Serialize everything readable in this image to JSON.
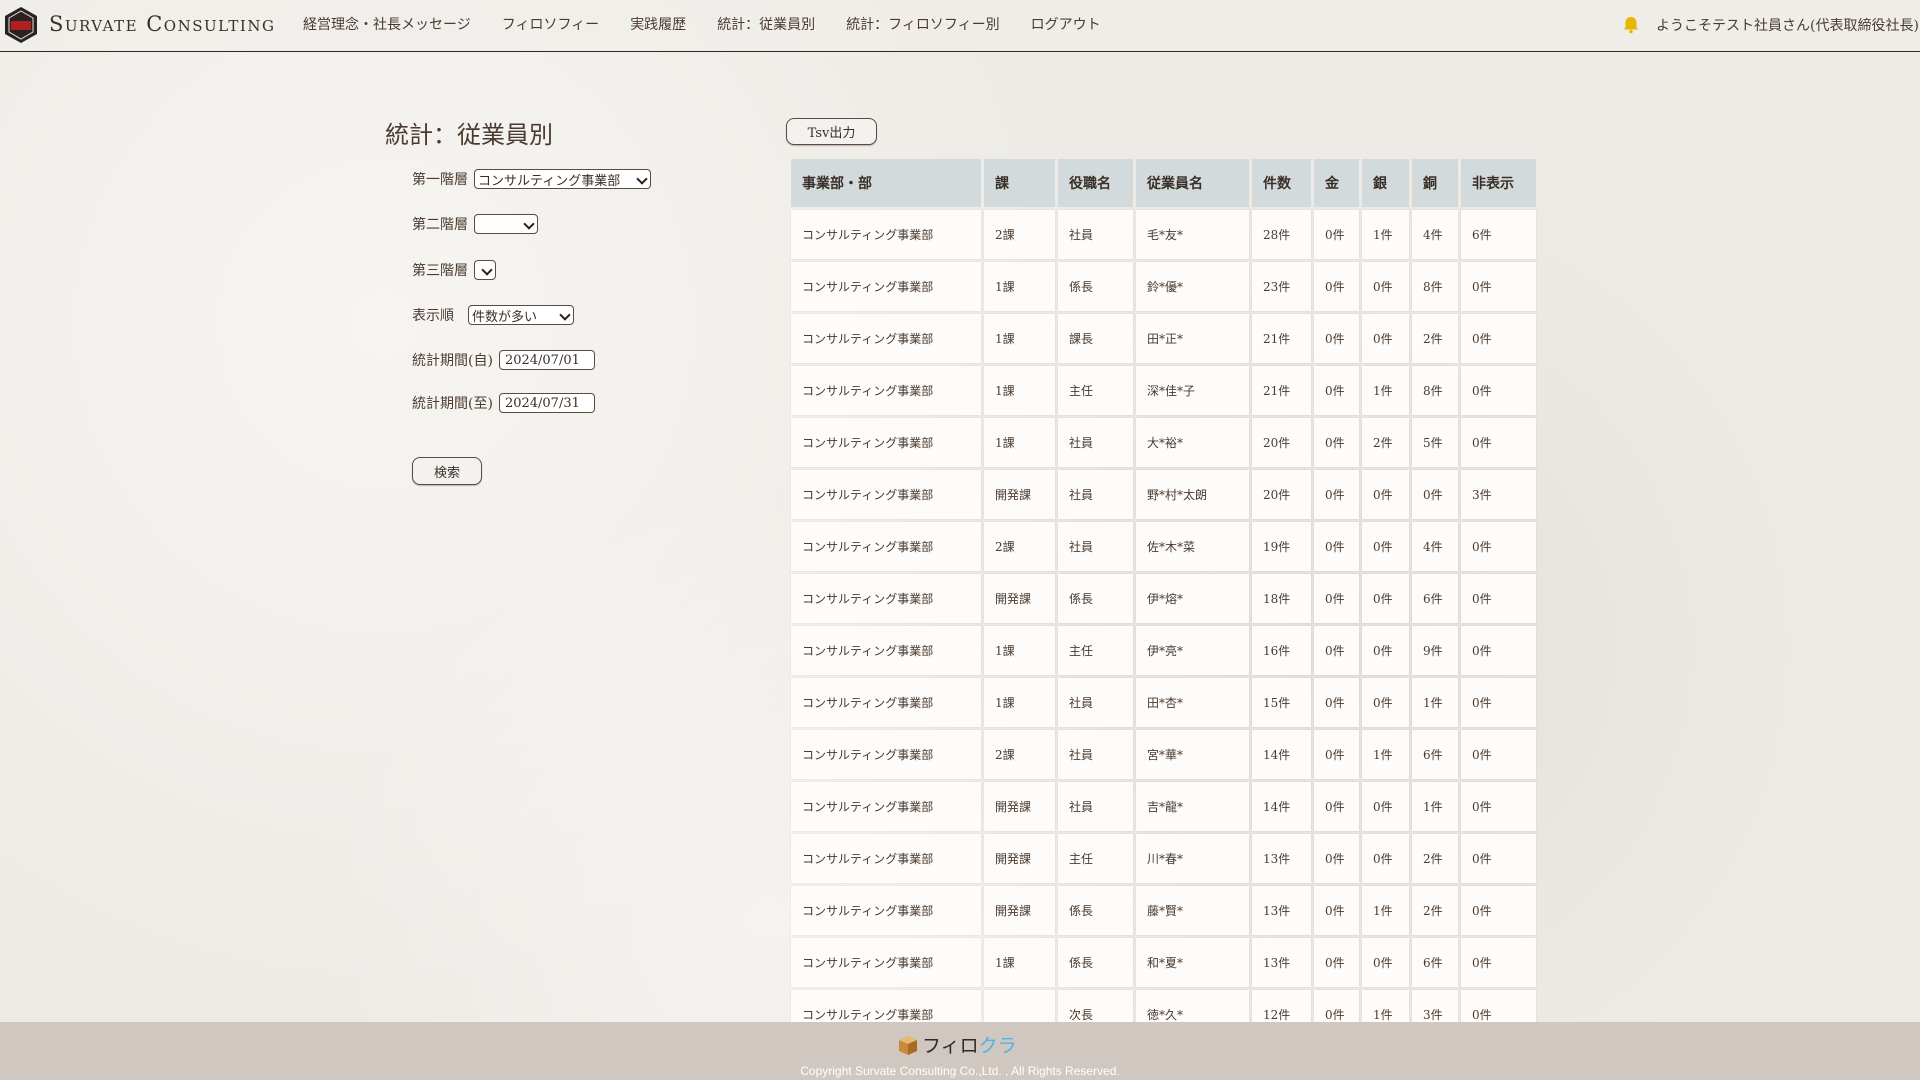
{
  "header": {
    "logo_text": "Survate Consulting",
    "nav": [
      "経営理念・社長メッセージ",
      "フィロソフィー",
      "実践履歴",
      "統計：従業員別",
      "統計：フィロソフィー別",
      "ログアウト"
    ],
    "welcome": "ようこそテスト社員さん(代表取締役社長)"
  },
  "page": {
    "title": "統計：従業員別"
  },
  "filters": {
    "level1_label": "第一階層",
    "level1_value": "コンサルティング事業部",
    "level2_label": "第二階層",
    "level2_value": "",
    "level3_label": "第三階層",
    "level3_value": "",
    "order_label": "表示順",
    "order_value": "件数が多い",
    "period_from_label": "統計期間(自)",
    "period_from_value": "2024/07/01",
    "period_to_label": "統計期間(至)",
    "period_to_value": "2024/07/31",
    "search_button": "検索"
  },
  "tsv_button": "Tsv出力",
  "table": {
    "headers": [
      "事業部・部",
      "課",
      "役職名",
      "従業員名",
      "件数",
      "金",
      "銀",
      "銅",
      "非表示"
    ],
    "rows": [
      [
        "コンサルティング事業部",
        "2課",
        "社員",
        "毛*友*",
        "28件",
        "0件",
        "1件",
        "4件",
        "6件"
      ],
      [
        "コンサルティング事業部",
        "1課",
        "係長",
        "鈴*優*",
        "23件",
        "0件",
        "0件",
        "8件",
        "0件"
      ],
      [
        "コンサルティング事業部",
        "1課",
        "課長",
        "田*正*",
        "21件",
        "0件",
        "0件",
        "2件",
        "0件"
      ],
      [
        "コンサルティング事業部",
        "1課",
        "主任",
        "深*佳*子",
        "21件",
        "0件",
        "1件",
        "8件",
        "0件"
      ],
      [
        "コンサルティング事業部",
        "1課",
        "社員",
        "大*裕*",
        "20件",
        "0件",
        "2件",
        "5件",
        "0件"
      ],
      [
        "コンサルティング事業部",
        "開発課",
        "社員",
        "野*村*太朗",
        "20件",
        "0件",
        "0件",
        "0件",
        "3件"
      ],
      [
        "コンサルティング事業部",
        "2課",
        "社員",
        "佐*木*菜",
        "19件",
        "0件",
        "0件",
        "4件",
        "0件"
      ],
      [
        "コンサルティング事業部",
        "開発課",
        "係長",
        "伊*熔*",
        "18件",
        "0件",
        "0件",
        "6件",
        "0件"
      ],
      [
        "コンサルティング事業部",
        "1課",
        "主任",
        "伊*亮*",
        "16件",
        "0件",
        "0件",
        "9件",
        "0件"
      ],
      [
        "コンサルティング事業部",
        "1課",
        "社員",
        "田*杏*",
        "15件",
        "0件",
        "0件",
        "1件",
        "0件"
      ],
      [
        "コンサルティング事業部",
        "2課",
        "社員",
        "宮*華*",
        "14件",
        "0件",
        "1件",
        "6件",
        "0件"
      ],
      [
        "コンサルティング事業部",
        "開発課",
        "社員",
        "吉*龍*",
        "14件",
        "0件",
        "0件",
        "1件",
        "0件"
      ],
      [
        "コンサルティング事業部",
        "開発課",
        "主任",
        "川*春*",
        "13件",
        "0件",
        "0件",
        "2件",
        "0件"
      ],
      [
        "コンサルティング事業部",
        "開発課",
        "係長",
        "藤*賢*",
        "13件",
        "0件",
        "1件",
        "2件",
        "0件"
      ],
      [
        "コンサルティング事業部",
        "1課",
        "係長",
        "和*夏*",
        "13件",
        "0件",
        "0件",
        "6件",
        "0件"
      ],
      [
        "コンサルティング事業部",
        "",
        "次長",
        "徳*久*",
        "12件",
        "0件",
        "1件",
        "3件",
        "0件"
      ]
    ]
  },
  "footer": {
    "logo_part1": "フィロ",
    "logo_part2": "クラ",
    "copyright": "Copyright Survate Consulting Co.,Ltd. , All Rights Reserved."
  },
  "colors": {
    "header_cell": "#d3dadb",
    "footer_bg": "#cfc7c0",
    "logo_accent": "#4fb4e8",
    "bell": "#e8b800"
  }
}
